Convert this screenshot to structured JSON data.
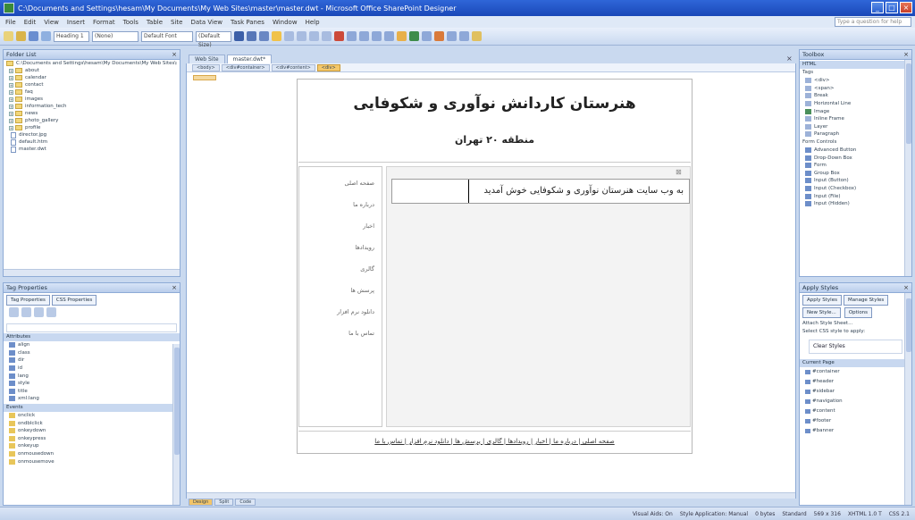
{
  "window": {
    "title": "C:\\Documents and Settings\\hesam\\My Documents\\My Web Sites\\master\\master.dwt - Microsoft Office SharePoint Designer"
  },
  "menu": [
    "File",
    "Edit",
    "View",
    "Insert",
    "Format",
    "Tools",
    "Table",
    "Site",
    "Data View",
    "Task Panes",
    "Window",
    "Help"
  ],
  "help_box": "Type a question for help",
  "toolbar": {
    "style_combo": "Heading 1",
    "font_combo": "Default Font",
    "size_combo": "(Default Size)",
    "style_label": "(None)"
  },
  "folder_list": {
    "title": "Folder List",
    "root": "C:\\Documents and Settings\\hesam\\My Documents\\My Web Sites\\master",
    "folders": [
      "about",
      "calendar",
      "contact",
      "faq",
      "images",
      "information_tech",
      "news",
      "photo_gallery",
      "profile"
    ],
    "files": [
      "director.jpg",
      "default.htm",
      "master.dwt"
    ]
  },
  "tag_properties": {
    "title": "Tag Properties",
    "tabs": [
      "Tag Properties",
      "CSS Properties"
    ],
    "attributes_header": "Attributes",
    "attributes": [
      "align",
      "class",
      "dir",
      "id",
      "lang",
      "style",
      "title",
      "xml:lang"
    ],
    "events_header": "Events",
    "events": [
      "onclick",
      "ondblclick",
      "onkeydown",
      "onkeypress",
      "onkeyup",
      "onmousedown",
      "onmousemove"
    ]
  },
  "document": {
    "tabs": [
      "Web Site",
      "master.dwt*"
    ],
    "breadcrumbs": [
      "<body>",
      "<div#container>",
      "<div#content>",
      "<div>"
    ],
    "header_title": "هنرستان کاردانش نوآوری و شکوفایی",
    "header_subtitle": "منطقه ۲۰ تهران",
    "side_links": [
      "صفحه اصلی",
      "درباره ما",
      "اخبار",
      "رویدادها",
      "گالری",
      "پرسش ها",
      "دانلود نرم افزار",
      "تماس با ما"
    ],
    "welcome_text": "به وب سایت هنرستان نوآوری و شکوفایی خوش آمدید",
    "footer_text": "صفحه اصلی | درباره ما | اخبار | رویدادها | گالری | پرسش ها | دانلود نرم افزار | تماس با ما",
    "view_tabs": [
      "Design",
      "Split",
      "Code"
    ]
  },
  "toolbox": {
    "title": "Toolbox",
    "sections": [
      "HTML",
      "Tags"
    ],
    "items": [
      "<div>",
      "<span>",
      "Break",
      "Horizontal Line",
      "Image",
      "Inline Frame",
      "Layer",
      "Paragraph",
      "Form Controls",
      "Advanced Button",
      "Drop-Down Box",
      "Form",
      "Group Box",
      "Input (Button)",
      "Input (Checkbox)",
      "Input (File)",
      "Input (Hidden)"
    ]
  },
  "apply_styles": {
    "title": "Apply Styles",
    "tabs": [
      "Apply Styles",
      "Manage Styles"
    ],
    "new_style": "New Style...",
    "options": "Options",
    "attach": "Attach Style Sheet...",
    "select_label": "Select CSS style to apply:",
    "clear": "Clear Styles",
    "current_page": "Current Page",
    "styles": [
      "#container",
      "#header",
      "#sidebar",
      "#navigation",
      "#content",
      "#footer",
      "#banner"
    ]
  },
  "status": {
    "visual_aids": "Visual Aids: On",
    "style_app": "Style Application: Manual",
    "size": "0 bytes",
    "standard": "Standard",
    "dimensions": "569 x 316",
    "doc": "XHTML 1.0 T",
    "css": "CSS 2.1"
  }
}
